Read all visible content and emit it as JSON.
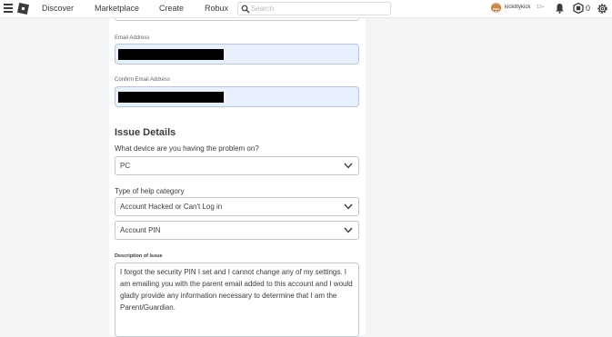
{
  "nav": {
    "discover": "Discover",
    "marketplace": "Marketplace",
    "create": "Create",
    "robux": "Robux",
    "search_placeholder": "Search",
    "username": "kickittykick",
    "age_tag": "13+",
    "robux_count": "0"
  },
  "form": {
    "email_label": "Email Address",
    "confirm_email_label": "Confirm Email Address",
    "issue_title": "Issue Details",
    "device_question": "What device are you having the problem on?",
    "device_value": "PC",
    "help_category_label": "Type of help category",
    "help_category_value": "Account Hacked or Can't Log in",
    "subcategory_value": "Account PIN",
    "description_label": "Description of Issue",
    "description_text": "I forgot the security PIN I set and I cannot change any of my settings. I am emailing you with the parent email added to this account and I would gladly provide any information necessary to determine that I am the Parent/Guardian."
  },
  "colors": {
    "autofill_bg": "#e8f0fe",
    "page_bg": "#f2f4f5",
    "redaction": "#000000"
  },
  "icons": [
    "menu-icon",
    "roblox-logo-icon",
    "search-icon",
    "avatar",
    "bell-icon",
    "robux-icon",
    "settings-icon",
    "chevron-down-icon"
  ]
}
